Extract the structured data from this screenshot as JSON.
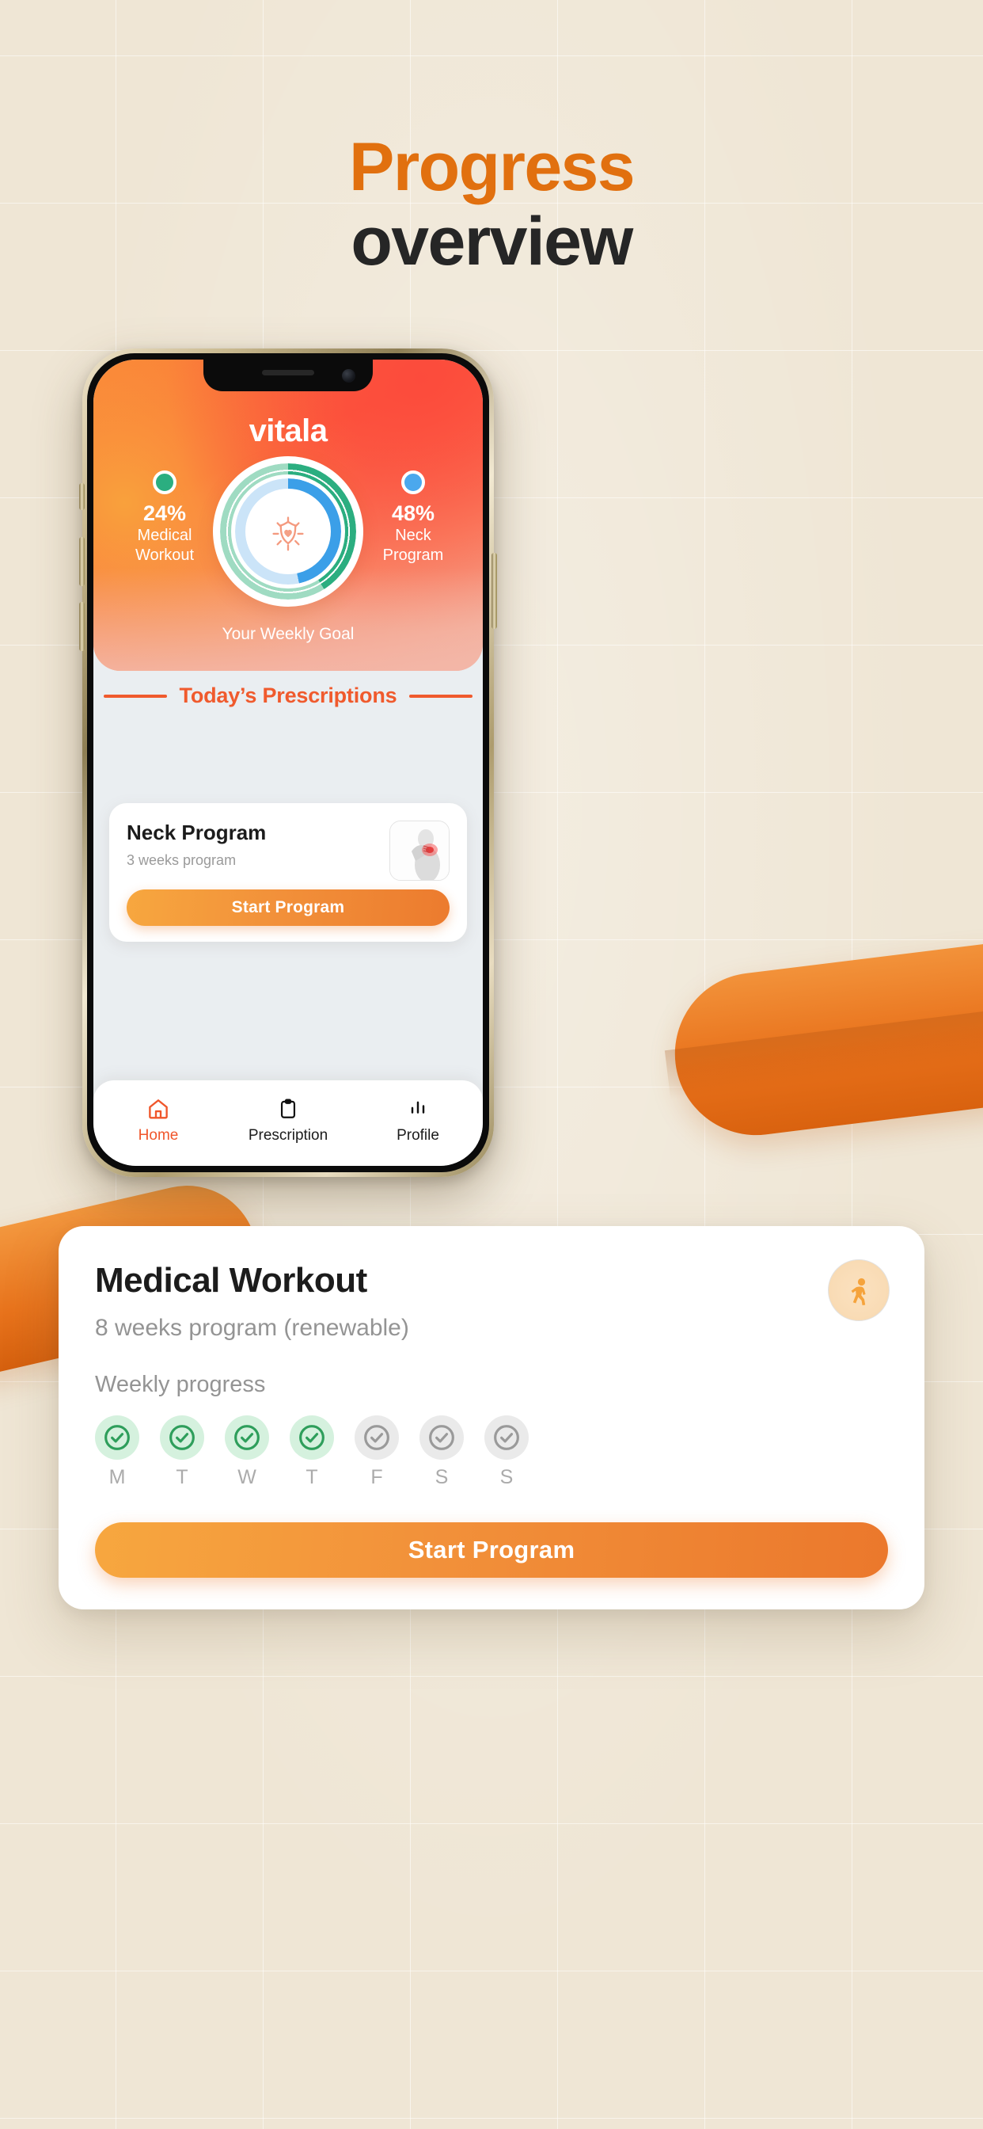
{
  "headline": {
    "line1": "Progress",
    "line2": "overview"
  },
  "colors": {
    "page_background": "#EFE6D5",
    "accent_orange": "#E1700F",
    "headline_dark": "#262626",
    "section_accent": "#F05A2D",
    "ring_green": "#2BAE80",
    "ring_green_track": "#9FDBC2",
    "ring_blue": "#3B9FE8",
    "ring_blue_track": "#CBE4F8",
    "check_done": "#2E9E5B",
    "check_todo": "#9A9A9A",
    "button_gradient_from": "#F7A73F",
    "button_gradient_to": "#EB782C",
    "nav_active": "#F0562B"
  },
  "app": {
    "brand": "vitala",
    "hero": {
      "weekly_goal_label": "Your Weekly Goal",
      "center_icon": "shield-heart-icon",
      "stats": [
        {
          "percent": "24%",
          "label": "Medical\nWorkout",
          "label_line1": "Medical",
          "label_line2": "Workout",
          "dot_color": "#2BAE80",
          "ring_value": 24
        },
        {
          "percent": "48%",
          "label": "Neck\nProgram",
          "label_line1": "Neck",
          "label_line2": "Program",
          "dot_color": "#4BA8ED",
          "ring_value": 48
        }
      ]
    },
    "section_header": {
      "title": "Today’s Prescriptions"
    },
    "cards": [
      {
        "title": "Medical Workout",
        "subtitle": "8 weeks program (renewable)",
        "weekly_progress_label": "Weekly progress",
        "badge_icon": "walking-person-icon",
        "button_label": "Start Program",
        "days": [
          {
            "label": "M",
            "done": true
          },
          {
            "label": "T",
            "done": true
          },
          {
            "label": "W",
            "done": true
          },
          {
            "label": "T",
            "done": true
          },
          {
            "label": "F",
            "done": false
          },
          {
            "label": "S",
            "done": false
          },
          {
            "label": "S",
            "done": false
          }
        ]
      },
      {
        "title": "Neck Program",
        "subtitle": "3 weeks program",
        "thumbnail_icon": "neck-pain-thumbnail",
        "button_label": "Start Program"
      }
    ],
    "bottom_nav": [
      {
        "label": "Home",
        "icon": "home-icon",
        "active": true
      },
      {
        "label": "Prescription",
        "icon": "clipboard-icon",
        "active": false
      },
      {
        "label": "Profile",
        "icon": "bar-chart-icon",
        "active": false
      }
    ]
  }
}
